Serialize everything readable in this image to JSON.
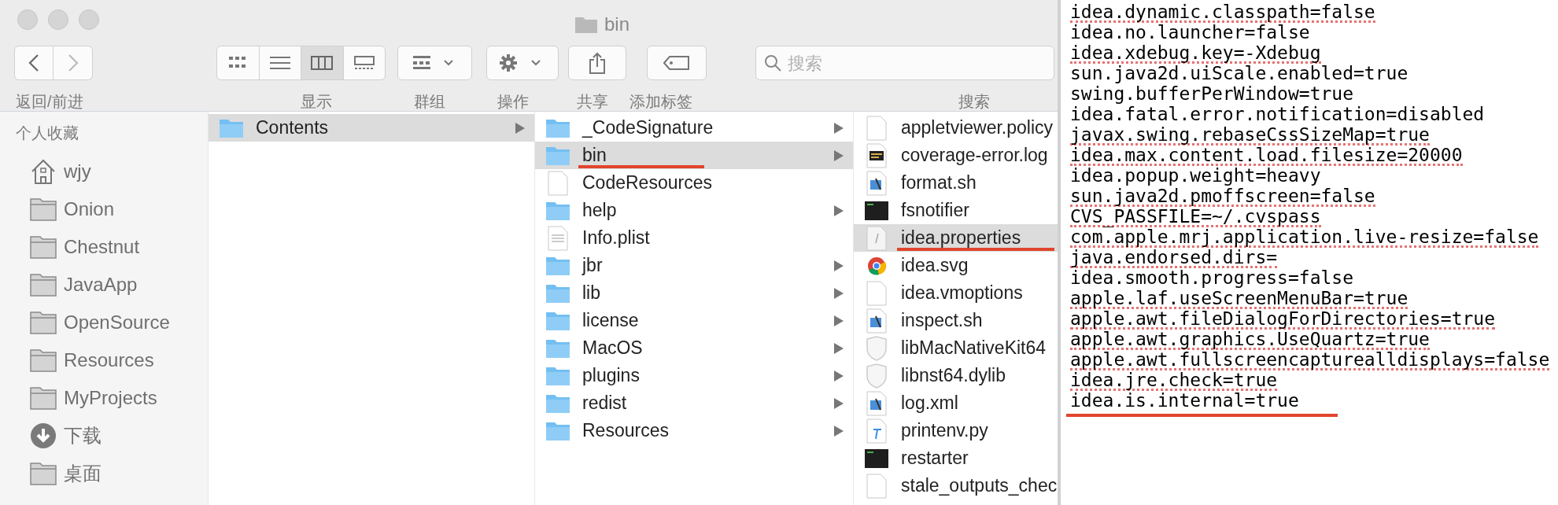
{
  "window": {
    "title": "bin"
  },
  "toolbar": {
    "nav_label": "返回/前进",
    "groups": [
      {
        "kind": "view",
        "label": "显示"
      },
      {
        "kind": "group",
        "label": "群组"
      },
      {
        "kind": "action",
        "label": "操作"
      },
      {
        "kind": "share",
        "label": "共享"
      },
      {
        "kind": "tag",
        "label": "添加标签"
      }
    ],
    "search": {
      "placeholder": "搜索",
      "label": "搜索"
    }
  },
  "sidebar": {
    "heading": "个人收藏",
    "items": [
      {
        "label": "wjy",
        "kind": "home"
      },
      {
        "label": "Onion",
        "kind": "folder"
      },
      {
        "label": "Chestnut",
        "kind": "folder"
      },
      {
        "label": "JavaApp",
        "kind": "folder"
      },
      {
        "label": "OpenSource",
        "kind": "folder"
      },
      {
        "label": "Resources",
        "kind": "folder"
      },
      {
        "label": "MyProjects",
        "kind": "folder"
      },
      {
        "label": "下载",
        "kind": "download"
      },
      {
        "label": "桌面",
        "kind": "folder"
      }
    ]
  },
  "columns": [
    {
      "items": [
        {
          "label": "Contents",
          "kind": "folder",
          "selected": true,
          "has_children": true,
          "annotated": false
        }
      ]
    },
    {
      "items": [
        {
          "label": "_CodeSignature",
          "kind": "folder",
          "selected": false,
          "has_children": true,
          "annotated": false
        },
        {
          "label": "bin",
          "kind": "folder",
          "selected": true,
          "has_children": true,
          "annotated": true
        },
        {
          "label": "CodeResources",
          "kind": "document",
          "selected": false,
          "has_children": false,
          "annotated": false
        },
        {
          "label": "help",
          "kind": "folder",
          "selected": false,
          "has_children": true,
          "annotated": false
        },
        {
          "label": "Info.plist",
          "kind": "plist",
          "selected": false,
          "has_children": false,
          "annotated": false
        },
        {
          "label": "jbr",
          "kind": "folder",
          "selected": false,
          "has_children": true,
          "annotated": false
        },
        {
          "label": "lib",
          "kind": "folder",
          "selected": false,
          "has_children": true,
          "annotated": false
        },
        {
          "label": "license",
          "kind": "folder",
          "selected": false,
          "has_children": true,
          "annotated": false
        },
        {
          "label": "MacOS",
          "kind": "folder",
          "selected": false,
          "has_children": true,
          "annotated": false
        },
        {
          "label": "plugins",
          "kind": "folder",
          "selected": false,
          "has_children": true,
          "annotated": false
        },
        {
          "label": "redist",
          "kind": "folder",
          "selected": false,
          "has_children": true,
          "annotated": false
        },
        {
          "label": "Resources",
          "kind": "folder",
          "selected": false,
          "has_children": true,
          "annotated": false
        }
      ]
    },
    {
      "items": [
        {
          "label": "appletviewer.policy",
          "kind": "document",
          "selected": false,
          "annotated": false
        },
        {
          "label": "coverage-error.log",
          "kind": "log",
          "selected": false,
          "annotated": false
        },
        {
          "label": "format.sh",
          "kind": "script",
          "selected": false,
          "annotated": false
        },
        {
          "label": "fsnotifier",
          "kind": "executable",
          "selected": false,
          "annotated": false
        },
        {
          "label": "idea.properties",
          "kind": "text",
          "selected": true,
          "annotated": true
        },
        {
          "label": "idea.svg",
          "kind": "web",
          "selected": false,
          "annotated": false
        },
        {
          "label": "idea.vmoptions",
          "kind": "document",
          "selected": false,
          "annotated": false
        },
        {
          "label": "inspect.sh",
          "kind": "script",
          "selected": false,
          "annotated": false
        },
        {
          "label": "libMacNativeKit64",
          "kind": "library",
          "selected": false,
          "annotated": false
        },
        {
          "label": "libnst64.dylib",
          "kind": "library",
          "selected": false,
          "annotated": false
        },
        {
          "label": "log.xml",
          "kind": "script",
          "selected": false,
          "annotated": false
        },
        {
          "label": "printenv.py",
          "kind": "python",
          "selected": false,
          "annotated": false
        },
        {
          "label": "restarter",
          "kind": "executable",
          "selected": false,
          "annotated": false
        },
        {
          "label": "stale_outputs_chec",
          "kind": "document",
          "selected": false,
          "annotated": false
        }
      ]
    }
  ],
  "editor": {
    "lines": [
      {
        "text": "idea.dynamic.classpath=false",
        "spell_flag": true,
        "annotated": false
      },
      {
        "text": "idea.no.launcher=false",
        "spell_flag": false,
        "annotated": false
      },
      {
        "text": "idea.xdebug.key=-Xdebug",
        "spell_flag": true,
        "annotated": false
      },
      {
        "text": "sun.java2d.uiScale.enabled=true",
        "spell_flag": false,
        "annotated": false
      },
      {
        "text": "swing.bufferPerWindow=true",
        "spell_flag": false,
        "annotated": false
      },
      {
        "text": "idea.fatal.error.notification=disabled",
        "spell_flag": false,
        "annotated": false
      },
      {
        "text": "javax.swing.rebaseCssSizeMap=true",
        "spell_flag": true,
        "annotated": false
      },
      {
        "text": "idea.max.content.load.filesize=20000",
        "spell_flag": true,
        "annotated": false
      },
      {
        "text": "idea.popup.weight=heavy",
        "spell_flag": false,
        "annotated": false
      },
      {
        "text": "sun.java2d.pmoffscreen=false",
        "spell_flag": true,
        "annotated": false
      },
      {
        "text": "CVS_PASSFILE=~/.cvspass",
        "spell_flag": true,
        "annotated": false
      },
      {
        "text": "com.apple.mrj.application.live-resize=false",
        "spell_flag": true,
        "annotated": false
      },
      {
        "text": "java.endorsed.dirs=",
        "spell_flag": true,
        "annotated": false
      },
      {
        "text": "idea.smooth.progress=false",
        "spell_flag": false,
        "annotated": false
      },
      {
        "text": "apple.laf.useScreenMenuBar=true",
        "spell_flag": true,
        "annotated": false
      },
      {
        "text": "apple.awt.fileDialogForDirectories=true",
        "spell_flag": true,
        "annotated": false
      },
      {
        "text": "apple.awt.graphics.UseQuartz=true",
        "spell_flag": true,
        "annotated": false
      },
      {
        "text": "apple.awt.fullscreencapturealldisplays=false",
        "spell_flag": true,
        "annotated": false
      },
      {
        "text": "idea.jre.check=true",
        "spell_flag": true,
        "annotated": false
      },
      {
        "text": "idea.is.internal=true",
        "spell_flag": false,
        "annotated": true
      }
    ]
  }
}
